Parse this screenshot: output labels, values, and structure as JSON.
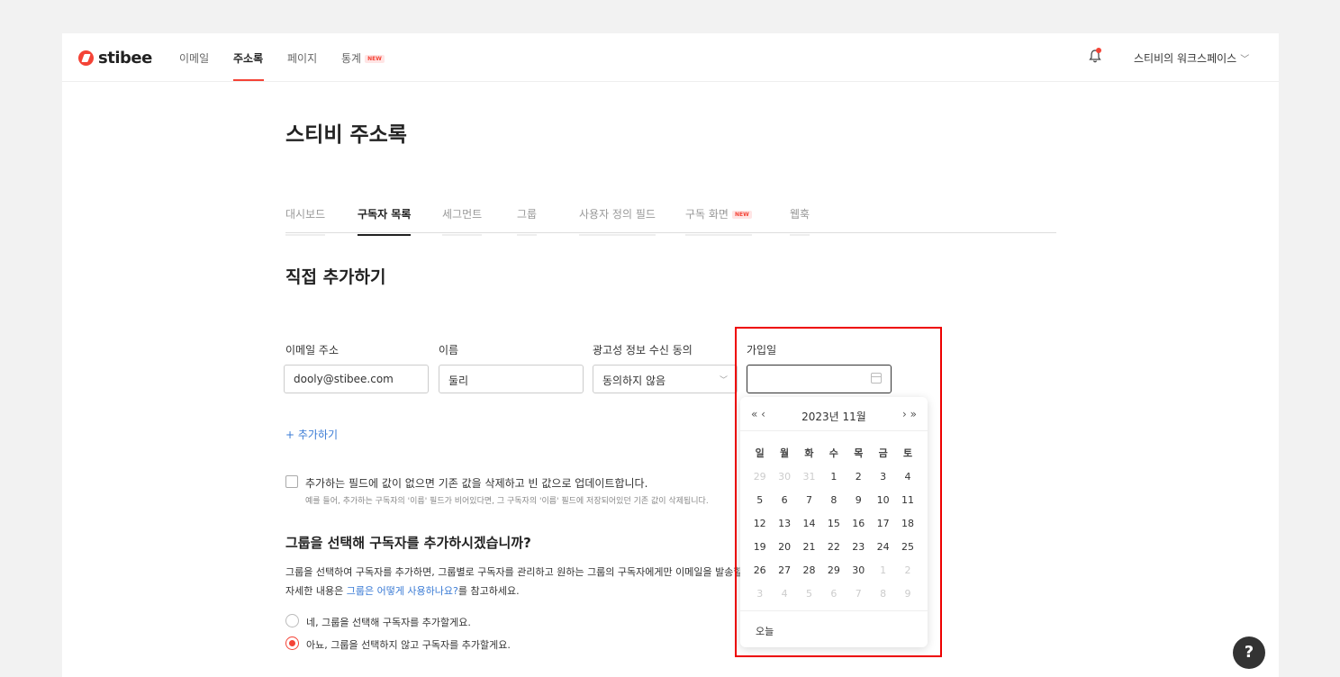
{
  "app": {
    "logo_text": "stibee"
  },
  "topnav": {
    "items": [
      {
        "label": "이메일"
      },
      {
        "label": "주소록"
      },
      {
        "label": "페이지"
      },
      {
        "label": "통계"
      }
    ],
    "new_badge": "NEW",
    "workspace": "스티비의 워크스페이스",
    "workspace_chevron": "﹀"
  },
  "page": {
    "title": "스티비 주소록",
    "tabs": [
      {
        "label": "대시보드"
      },
      {
        "label": "구독자 목록"
      },
      {
        "label": "세그먼트"
      },
      {
        "label": "그룹"
      },
      {
        "label": "사용자 정의 필드"
      },
      {
        "label": "구독 화면"
      },
      {
        "label": "웹훅"
      }
    ],
    "tab_new_badge": "NEW",
    "section_title": "직접 추가하기"
  },
  "form": {
    "email": {
      "label": "이메일 주소",
      "value": "dooly@stibee.com"
    },
    "name": {
      "label": "이름",
      "value": "둘리"
    },
    "consent": {
      "label": "광고성 정보 수신 동의",
      "value": "동의하지 않음"
    },
    "joined": {
      "label": "가입일",
      "value": ""
    },
    "add_link": "+ 추가하기",
    "update_checkbox": {
      "label": "추가하는 필드에 값이 없으면 기존 값을 삭제하고 빈 값으로 업데이트합니다.",
      "description": "예를 들어, 추가하는 구독자의 '이름' 필드가 비어있다면, 그 구독자의 '이름' 필드에 저장되어있던 기존 값이 삭제됩니다."
    }
  },
  "group_question": {
    "title": "그룹을 선택해 구독자를 추가하시겠습니까?",
    "desc": "그룹을 선택하여 구독자를 추가하면, 그룹별로 구독자를 관리하고 원하는 그룹의 구독자에게만 이메일을 발송할 수 있습니다.",
    "desc2_prefix": "자세한 내용은 ",
    "desc2_link": "그룹은 어떻게 사용하나요?",
    "desc2_suffix": "를 참고하세요.",
    "option_yes": "네, 그룹을 선택해 구독자를 추가할게요.",
    "option_no": "아뇨, 그룹을 선택하지 않고 구독자를 추가할게요.",
    "selected": "no"
  },
  "datepicker": {
    "prev": "« ‹",
    "month_label": "2023년 11월",
    "next": "› »",
    "weekdays": [
      "일",
      "월",
      "화",
      "수",
      "목",
      "금",
      "토"
    ],
    "weeks": [
      [
        [
          "29",
          1
        ],
        [
          "30",
          1
        ],
        [
          "31",
          1
        ],
        [
          "1",
          0
        ],
        [
          "2",
          0
        ],
        [
          "3",
          0
        ],
        [
          "4",
          0
        ]
      ],
      [
        [
          "5",
          0
        ],
        [
          "6",
          0
        ],
        [
          "7",
          0
        ],
        [
          "8",
          0
        ],
        [
          "9",
          0
        ],
        [
          "10",
          0
        ],
        [
          "11",
          0
        ]
      ],
      [
        [
          "12",
          0
        ],
        [
          "13",
          0
        ],
        [
          "14",
          0
        ],
        [
          "15",
          0
        ],
        [
          "16",
          0
        ],
        [
          "17",
          0
        ],
        [
          "18",
          0
        ]
      ],
      [
        [
          "19",
          0
        ],
        [
          "20",
          0
        ],
        [
          "21",
          0
        ],
        [
          "22",
          0
        ],
        [
          "23",
          0
        ],
        [
          "24",
          0
        ],
        [
          "25",
          0
        ]
      ],
      [
        [
          "26",
          0
        ],
        [
          "27",
          0
        ],
        [
          "28",
          0
        ],
        [
          "29",
          0
        ],
        [
          "30",
          0
        ],
        [
          "1",
          1
        ],
        [
          "2",
          1
        ]
      ],
      [
        [
          "3",
          1
        ],
        [
          "4",
          1
        ],
        [
          "5",
          1
        ],
        [
          "6",
          1
        ],
        [
          "7",
          1
        ],
        [
          "8",
          1
        ],
        [
          "9",
          1
        ]
      ]
    ],
    "today_label": "오늘"
  },
  "help": {
    "label": "?"
  },
  "colors": {
    "accent": "#f44336",
    "link": "#3a7bd5",
    "highlight": "#ee0000"
  }
}
